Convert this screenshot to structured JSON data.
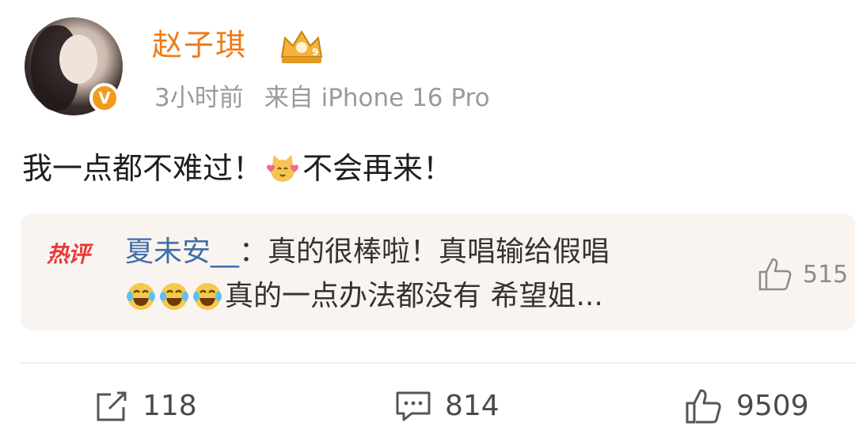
{
  "post": {
    "username": "赵子琪",
    "verified_badge": "V",
    "time": "3小时前",
    "source": "来自 iPhone 16 Pro",
    "text_part1": "我一点都不难过！",
    "text_part2": "不会再来！",
    "emoji": "cat-emoji-icon"
  },
  "hot_comment": {
    "tag": "热评",
    "user": "夏未安__",
    "separator": "：",
    "line1_text": "真的很棒啦！真唱输给假唱",
    "line2_text": "真的一点办法都没有 希望姐...",
    "likes": "515"
  },
  "actions": {
    "repost_count": "118",
    "comment_count": "814",
    "like_count": "9509"
  },
  "colors": {
    "username": "#f07a14",
    "comment_user": "#3f6ea8",
    "hot_tag": "#e83a3a",
    "badge": "#f39a1e"
  }
}
